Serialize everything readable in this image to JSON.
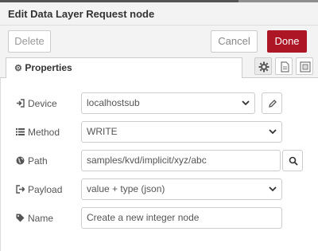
{
  "dialog": {
    "title": "Edit Data Layer Request node",
    "buttons": {
      "delete": "Delete",
      "cancel": "Cancel",
      "done": "Done"
    },
    "done_color": "#ad1625"
  },
  "tabs": {
    "active": {
      "label": "Properties",
      "icon": "gear-icon"
    },
    "icons": [
      "settings-icon",
      "description-icon",
      "appearance-icon"
    ]
  },
  "form": {
    "device": {
      "label": "Device",
      "icon": "sign-in-icon",
      "value": "localhostsub"
    },
    "method": {
      "label": "Method",
      "icon": "list-icon",
      "value": "WRITE"
    },
    "path": {
      "label": "Path",
      "icon": "globe-icon",
      "value": "samples/kvd/implicit/xyz/abc"
    },
    "payload": {
      "label": "Payload",
      "icon": "sign-out-icon",
      "value": "value + type (json)"
    },
    "name": {
      "label": "Name",
      "icon": "tag-icon",
      "value": "Create a new integer node"
    }
  }
}
